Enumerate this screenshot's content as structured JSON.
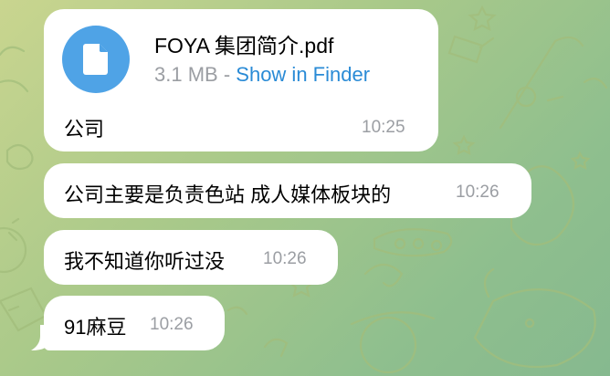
{
  "colors": {
    "accent": "#4fa3e6",
    "link": "#2a8bd6",
    "bubble": "#ffffff",
    "time": "#9b9ea3"
  },
  "file_message": {
    "icon": "document-icon",
    "file_name": "FOYA 集团简介.pdf",
    "file_size": "3.1 MB",
    "separator": "-",
    "action_label": "Show in Finder",
    "caption": "公司",
    "time": "10:25"
  },
  "messages": [
    {
      "text": "公司主要是负责色站 成人媒体板块的",
      "time": "10:26"
    },
    {
      "text": "我不知道你听过没",
      "time": "10:26"
    },
    {
      "text": "91麻豆",
      "time": "10:26"
    }
  ]
}
